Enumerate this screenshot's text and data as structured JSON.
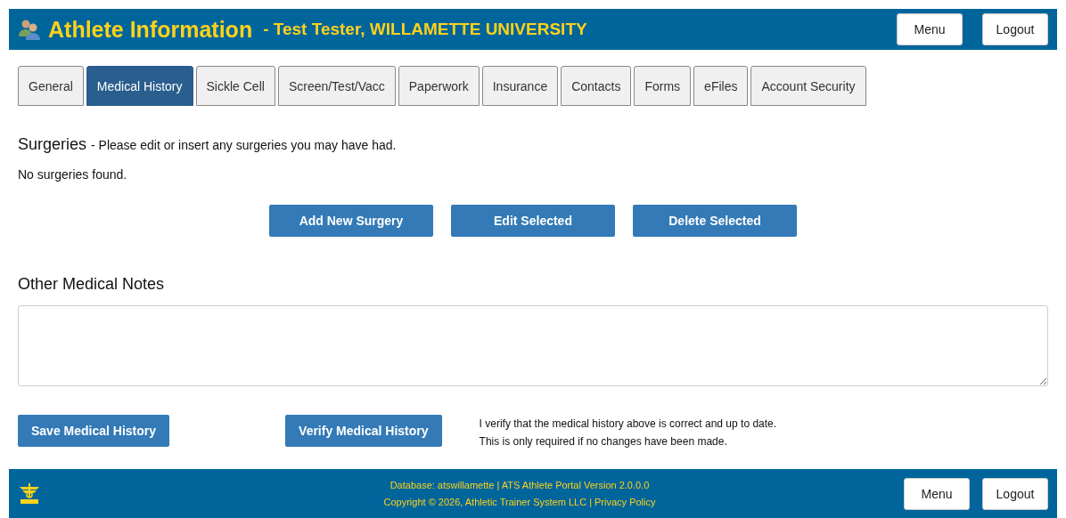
{
  "header": {
    "title": "Athlete Information",
    "subtitle": "- Test Tester, WILLAMETTE UNIVERSITY",
    "buttons": [
      "Menu",
      "Logout"
    ]
  },
  "tabs": [
    {
      "label": "General",
      "selected": false
    },
    {
      "label": "Medical History",
      "selected": true
    },
    {
      "label": "Sickle Cell",
      "selected": false
    },
    {
      "label": "Screen/Test/Vacc",
      "selected": false
    },
    {
      "label": "Paperwork",
      "selected": false
    },
    {
      "label": "Insurance",
      "selected": false
    },
    {
      "label": "Contacts",
      "selected": false
    },
    {
      "label": "Forms",
      "selected": false
    },
    {
      "label": "eFiles",
      "selected": false
    },
    {
      "label": "Account Security",
      "selected": false
    }
  ],
  "surgeries": {
    "title": "Surgeries",
    "subtitle": "- Please edit or insert any surgeries you may have had.",
    "empty_message": "No surgeries found.",
    "buttons": [
      "Add New Surgery",
      "Edit Selected",
      "Delete Selected"
    ]
  },
  "notes": {
    "title": "Other Medical Notes"
  },
  "actions": {
    "save": "Save Medical History",
    "verify": "Verify Medical History",
    "verify_note": [
      "I verify that the medical history above is correct and up to date.",
      "This is only required if no changes have been made."
    ]
  },
  "footer": {
    "database": "Database: atswillamette | ATS Athlete Portal Version 2.0.0.0",
    "copyright": "Copyright © 2026, Athletic Trainer System LLC |",
    "privacy_link": "Privacy Policy",
    "buttons": [
      "Menu",
      "Logout"
    ]
  }
}
